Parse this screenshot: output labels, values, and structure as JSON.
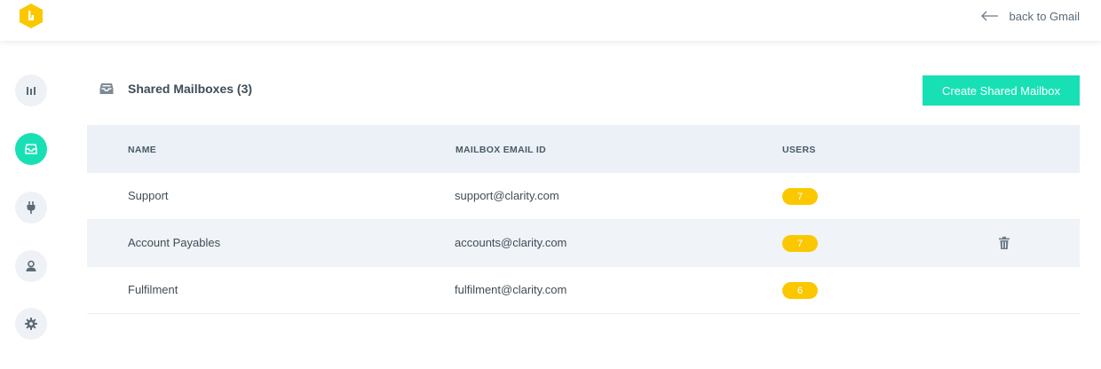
{
  "header": {
    "back_label": "back to Gmail"
  },
  "sidebar": {
    "items": [
      {
        "name": "dashboard",
        "icon": "bar-chart-icon"
      },
      {
        "name": "shared-mailboxes",
        "icon": "inbox-icon",
        "active": true
      },
      {
        "name": "integrations",
        "icon": "plug-icon"
      },
      {
        "name": "users",
        "icon": "user-icon"
      },
      {
        "name": "settings",
        "icon": "gear-icon"
      }
    ]
  },
  "main": {
    "title": "Shared Mailboxes (3)",
    "create_button": "Create Shared Mailbox",
    "columns": [
      "NAME",
      "MAILBOX EMAIL ID",
      "USERS"
    ],
    "rows": [
      {
        "name": "Support",
        "email": "support@clarity.com",
        "users": "7"
      },
      {
        "name": "Account Payables",
        "email": "accounts@clarity.com",
        "users": "7"
      },
      {
        "name": "Fulfilment",
        "email": "fulfilment@clarity.com",
        "users": "6"
      }
    ]
  },
  "colors": {
    "accent": "#18e0b5",
    "badge": "#fbc800",
    "logo": "#fbc800",
    "header_row": "#ebf1f7"
  }
}
